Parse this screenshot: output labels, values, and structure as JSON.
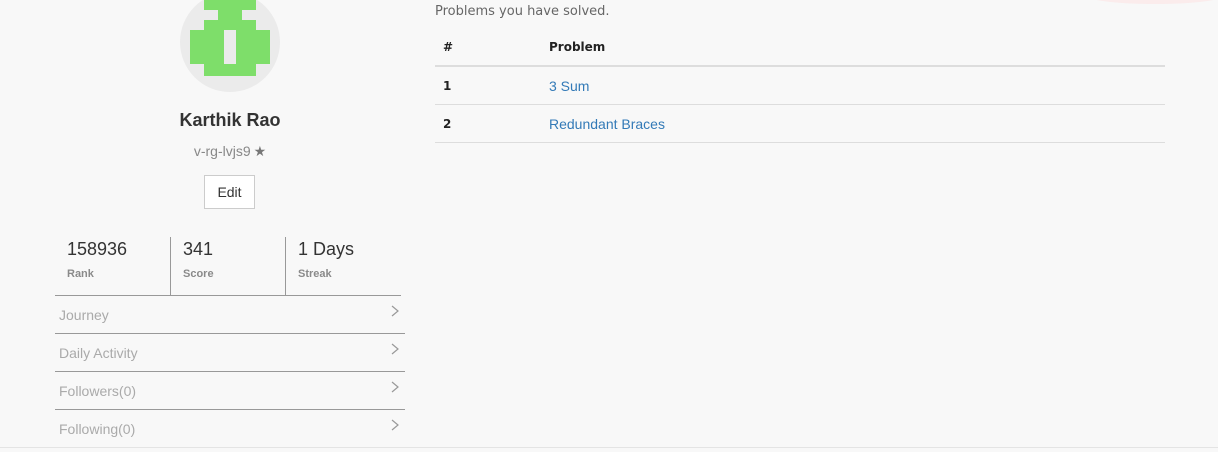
{
  "profile": {
    "name": "Karthik Rao",
    "handle": "v-rg-lvjs9",
    "handle_icon": "star-icon",
    "edit_label": "Edit",
    "avatar_color": "#7ede6a"
  },
  "stats": [
    {
      "value": "158936",
      "label": "Rank"
    },
    {
      "value": "341",
      "label": "Score"
    },
    {
      "value": "1 Days",
      "label": "Streak"
    }
  ],
  "menu": [
    {
      "label": "Journey",
      "icon": "chevron-right-icon"
    },
    {
      "label": "Daily Activity",
      "icon": "chevron-right-icon"
    },
    {
      "label": "Followers(0)",
      "icon": "chevron-right-icon"
    },
    {
      "label": "Following(0)",
      "icon": "chevron-right-icon"
    }
  ],
  "problems": {
    "caption": "Problems you have solved.",
    "columns": [
      "#",
      "Problem"
    ],
    "rows": [
      {
        "num": "1",
        "name": "3 Sum"
      },
      {
        "num": "2",
        "name": "Redundant Braces"
      }
    ]
  },
  "colors": {
    "background": "#f8f8f8",
    "link": "#337ab7",
    "muted_text": "#aaaaaa",
    "divider": "#999999"
  }
}
